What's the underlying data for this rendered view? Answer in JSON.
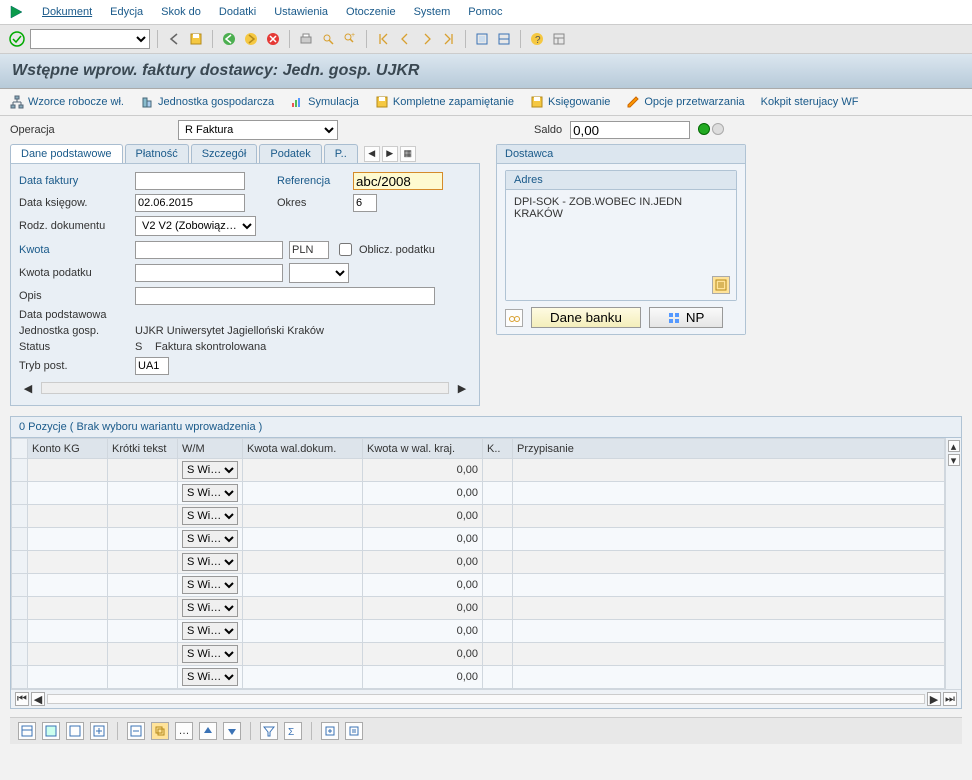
{
  "menu": {
    "items": [
      "Dokument",
      "Edycja",
      "Skok do",
      "Dodatki",
      "Ustawienia",
      "Otoczenie",
      "System",
      "Pomoc"
    ]
  },
  "page_title": "Wstępne wprow. faktury dostawcy: Jedn. gosp. UJKR",
  "actions": {
    "a0": "Wzorce robocze wł.",
    "a1": "Jednostka gospodarcza",
    "a2": "Symulacja",
    "a3": "Kompletne zapamiętanie",
    "a4": "Księgowanie",
    "a5": "Opcje przetwarzania",
    "a6": "Kokpit sterujacy WF"
  },
  "operation": {
    "label": "Operacja",
    "value": "R Faktura"
  },
  "balance": {
    "label": "Saldo",
    "value": "0,00"
  },
  "tabs": [
    "Dane podstawowe",
    "Płatność",
    "Szczegół",
    "Podatek",
    "P.."
  ],
  "basic": {
    "invoice_date_label": "Data faktury",
    "invoice_date": "",
    "ref_label": "Referencja",
    "ref": "abc/2008",
    "posting_date_label": "Data księgow.",
    "posting_date": "02.06.2015",
    "period_label": "Okres",
    "period": "6",
    "doctype_label": "Rodz. dokumentu",
    "doctype": "V2 V2 (Zobowiąz…",
    "amount_label": "Kwota",
    "amount": "",
    "currency": "PLN",
    "calc_tax_label": "Oblicz. podatku",
    "tax_amount_label": "Kwota podatku",
    "tax_amount": "",
    "text_label": "Opis",
    "text": "",
    "basic_data_label": "Data podstawowa",
    "company_label": "Jednostka gosp.",
    "company": "UJKR Uniwersytet Jagielloński Kraków",
    "status_label": "Status",
    "status_code": "S",
    "status_text": "Faktura skontrolowana",
    "entry_mode_label": "Tryb post.",
    "entry_mode": "UA1"
  },
  "vendor": {
    "group": "Dostawca",
    "address_label": "Adres",
    "line1": "DPI-SOK - ZOB.WOBEC IN.JEDN",
    "line2": "KRAKÓW",
    "bank_btn": "Dane banku",
    "np_btn": "NP"
  },
  "items": {
    "caption": "0 Pozycje ( Brak wyboru wariantu wprowadzenia )",
    "cols": [
      "Konto KG",
      "Krótki tekst",
      "W/M",
      "Kwota wal.dokum.",
      "Kwota w wal. kraj.",
      "K..",
      "Przypisanie"
    ],
    "wm_value": "S Wi…",
    "rows": [
      {
        "amt_dc": "",
        "amt_lc": "0,00"
      },
      {
        "amt_dc": "",
        "amt_lc": "0,00"
      },
      {
        "amt_dc": "",
        "amt_lc": "0,00"
      },
      {
        "amt_dc": "",
        "amt_lc": "0,00"
      },
      {
        "amt_dc": "",
        "amt_lc": "0,00"
      },
      {
        "amt_dc": "",
        "amt_lc": "0,00"
      },
      {
        "amt_dc": "",
        "amt_lc": "0,00"
      },
      {
        "amt_dc": "",
        "amt_lc": "0,00"
      },
      {
        "amt_dc": "",
        "amt_lc": "0,00"
      },
      {
        "amt_dc": "",
        "amt_lc": "0,00"
      }
    ]
  }
}
